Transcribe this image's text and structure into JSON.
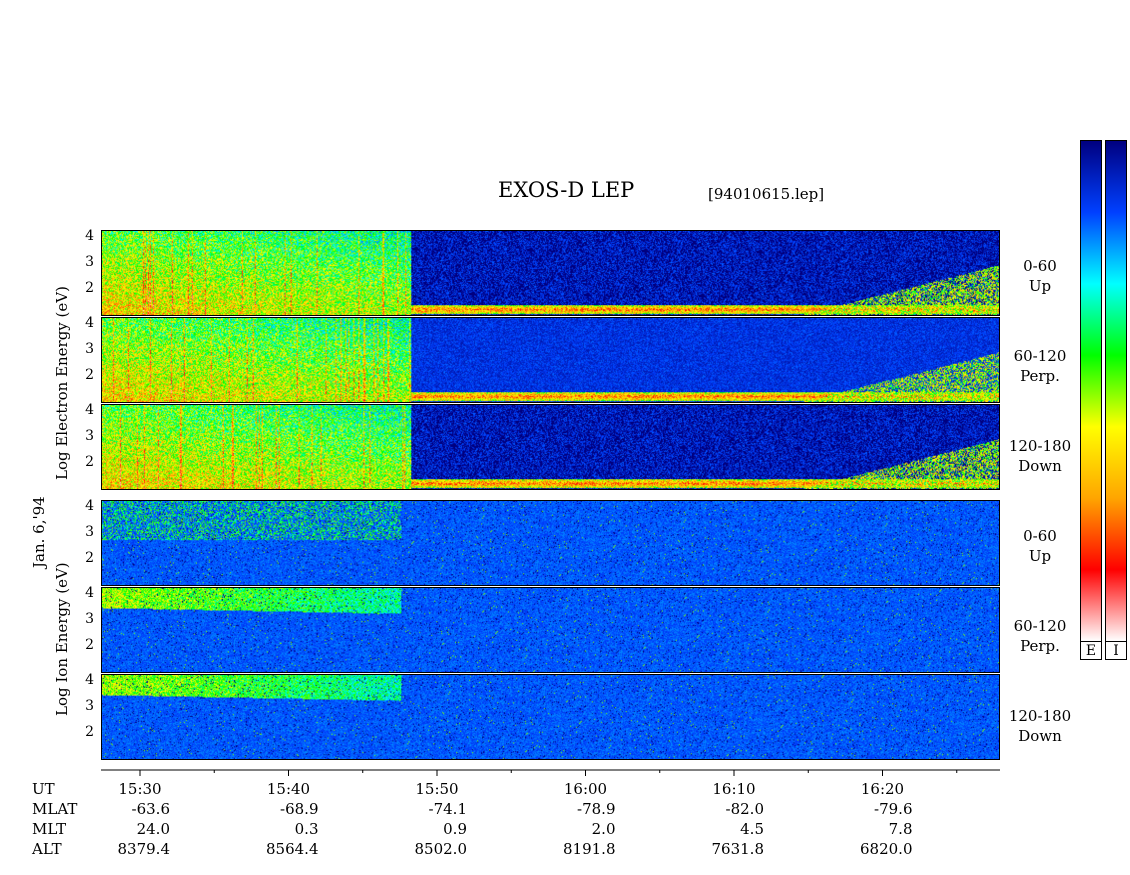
{
  "title": "EXOS-D LEP",
  "filename": "[94010615.lep]",
  "date_label": "Jan. 6,'94",
  "electron_ylabel": "Log   Electron   Energy  (eV)",
  "ion_ylabel": "Log   Ion   Energy  (eV)",
  "panels": [
    {
      "species": "electron",
      "pitch_range": "0-60",
      "direction": "Up"
    },
    {
      "species": "electron",
      "pitch_range": "60-120",
      "direction": "Perp."
    },
    {
      "species": "electron",
      "pitch_range": "120-180",
      "direction": "Down"
    },
    {
      "species": "ion",
      "pitch_range": "0-60",
      "direction": "Up"
    },
    {
      "species": "ion",
      "pitch_range": "60-120",
      "direction": "Perp."
    },
    {
      "species": "ion",
      "pitch_range": "120-180",
      "direction": "Down"
    }
  ],
  "yticks": [
    "4",
    "3",
    "2"
  ],
  "colorbar_keys": [
    "E",
    "I"
  ],
  "orbit_table": {
    "row_labels": [
      "UT",
      "MLAT",
      "MLT",
      "ALT"
    ],
    "columns": [
      {
        "UT": "15:30",
        "MLAT": "-63.6",
        "MLT": "24.0",
        "ALT": "8379.4"
      },
      {
        "UT": "15:40",
        "MLAT": "-68.9",
        "MLT": "0.3",
        "ALT": "8564.4"
      },
      {
        "UT": "15:50",
        "MLAT": "-74.1",
        "MLT": "0.9",
        "ALT": "8502.0"
      },
      {
        "UT": "16:00",
        "MLAT": "-78.9",
        "MLT": "2.0",
        "ALT": "8191.8"
      },
      {
        "UT": "16:10",
        "MLAT": "-82.0",
        "MLT": "4.5",
        "ALT": "7631.8"
      },
      {
        "UT": "16:20",
        "MLAT": "-79.6",
        "MLT": "7.8",
        "ALT": "6820.0"
      }
    ]
  },
  "chart_data": {
    "type": "heatmap",
    "title": "EXOS-D LEP",
    "xlabel": "UT",
    "ylabel": "Log Energy (eV)",
    "x_ticks": [
      "15:30",
      "15:40",
      "15:50",
      "16:00",
      "16:10",
      "16:20"
    ],
    "x_range": [
      "15:27",
      "16:28"
    ],
    "y_range": [
      1,
      4.2
    ],
    "y_ticks": [
      2,
      3,
      4
    ],
    "colormap": [
      "#ffffff",
      "#ff0000",
      "#ffa500",
      "#ffff00",
      "#00ff00",
      "#00ffff",
      "#0040ff",
      "#000080"
    ],
    "colorbar_keys": [
      "E",
      "I"
    ]
  }
}
